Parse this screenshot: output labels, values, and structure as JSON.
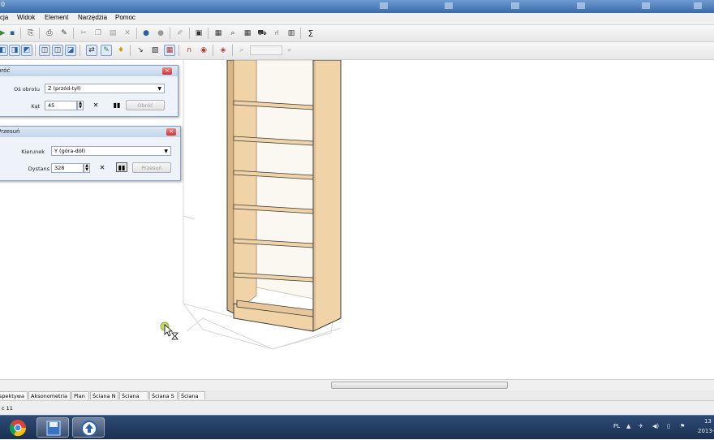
{
  "menu": [
    "cja",
    "Widok",
    "Element",
    "Narzędzia",
    "Pomoc"
  ],
  "rotate_dialog": {
    "title": "bróć",
    "close": "×",
    "axis_label": "Oś obrotu",
    "axis_value": "Z (przód-tył)",
    "angle_label": "Kąt",
    "angle_value": "45",
    "apply_label": "Obróć"
  },
  "move_dialog": {
    "title": "Przesuń",
    "close": "×",
    "direction_label": "Kierunek",
    "direction_value": "Y (góra-dół)",
    "distance_label": "Dystans",
    "distance_value": "328",
    "apply_label": "Przesuń"
  },
  "view_tabs": [
    "spektywa",
    "Aksonometria",
    "Plan",
    "Ściana N",
    "Ściana W",
    "Ściana S",
    "Ściana E"
  ],
  "status": "c 11",
  "tray": {
    "lang": "PL",
    "time": "13",
    "date": "2013-"
  },
  "colors": {
    "wood": "#f1d3a8",
    "wood_dark": "#d9b585",
    "edge": "#3a3a3a",
    "guide": "#d6d6d6"
  }
}
